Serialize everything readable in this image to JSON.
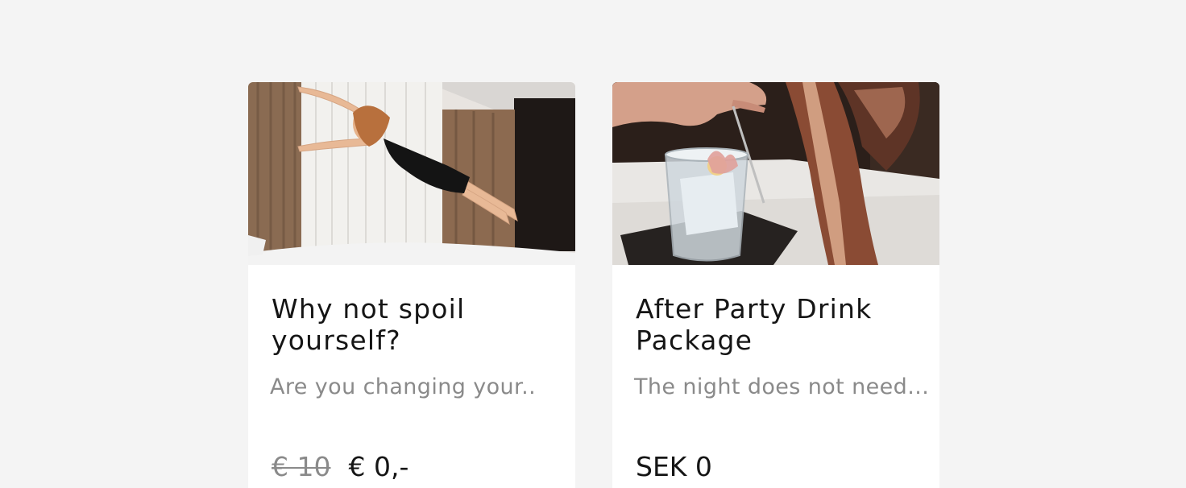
{
  "cards": [
    {
      "title": "Why not spoil yourself?",
      "description": "Are you changing your..",
      "price_old": "€ 10",
      "price": "€ 0,-",
      "image": "woman-jumping-on-bed"
    },
    {
      "title": "After Party Drink Package",
      "description": "The night does not need...",
      "price": "SEK 0",
      "image": "cocktail-being-poured"
    }
  ],
  "colors": {
    "background": "#f4f4f4",
    "card": "#ffffff",
    "title": "#151515",
    "muted": "#8a8a8a"
  }
}
